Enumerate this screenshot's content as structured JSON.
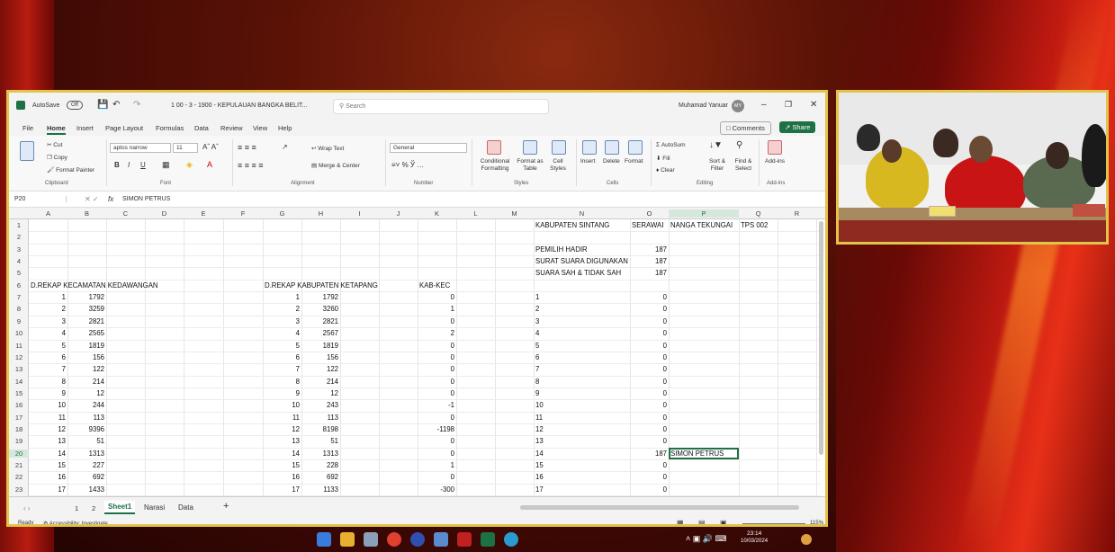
{
  "window": {
    "autosave": "AutoSave",
    "autosave_state": "Off",
    "filename": "1 00 - 3 - 1900 - KEPULAUAN BANGKA BELIT...",
    "search_placeholder": "Search",
    "user": "Muhamad Yanuar",
    "user_initials": "MY",
    "comments": "Comments",
    "share": "Share"
  },
  "menu": [
    "File",
    "Home",
    "Insert",
    "Page Layout",
    "Formulas",
    "Data",
    "Review",
    "View",
    "Help"
  ],
  "ribbon": {
    "cut": "Cut",
    "copy": "Copy",
    "format_painter": "Format Painter",
    "clipboard": "Clipboard",
    "font_name": "aptos narrow",
    "font_size": "11",
    "font_group": "Font",
    "alignment": "Alignment",
    "wrap_text": "Wrap Text",
    "merge_center": "Merge & Center",
    "number_format": "General",
    "number": "Number",
    "conditional": "Conditional Formatting",
    "format_table": "Format as Table",
    "cell_styles": "Cell Styles",
    "styles": "Styles",
    "insert": "Insert",
    "delete": "Delete",
    "format": "Format",
    "cells": "Cells",
    "autosum": "AutoSum",
    "fill": "Fill",
    "clear": "Clear",
    "sort_filter": "Sort & Filter",
    "find_select": "Find & Select",
    "editing": "Editing",
    "addins": "Add-ins",
    "addins_group": "Add-ins"
  },
  "formula": {
    "namebox": "P20",
    "fx": "fx",
    "content": "SIMON PETRUS"
  },
  "columns": [
    "A",
    "B",
    "C",
    "D",
    "E",
    "F",
    "G",
    "H",
    "I",
    "J",
    "K",
    "L",
    "M",
    "N",
    "O",
    "P",
    "Q",
    "R"
  ],
  "rows": [
    "1",
    "2",
    "3",
    "4",
    "5",
    "6",
    "7",
    "8",
    "9",
    "10",
    "11",
    "12",
    "13",
    "14",
    "15",
    "16",
    "17",
    "18",
    "19",
    "20",
    "21",
    "22",
    "23"
  ],
  "cells": {
    "n1": "KABUPATEN SINTANG",
    "o1": "SERAWAI",
    "p1": "NANGA TEKUNGAI",
    "q1": "TPS 002",
    "n3": "PEMILIH HADIR",
    "o3": "187",
    "n4": "SURAT SUARA DIGUNAKAN",
    "o4": "187",
    "n5": "SUARA SAH & TIDAK SAH",
    "o5": "187",
    "a6": "D.REKAP KECAMATAN KEDAWANGAN",
    "g6": "D.REKAP KABUPATEN KETAPANG",
    "k6": "KAB-KEC",
    "p20": "SIMON PETRUS"
  },
  "colA": [
    "1",
    "2",
    "3",
    "4",
    "5",
    "6",
    "7",
    "8",
    "9",
    "10",
    "11",
    "12",
    "13",
    "14",
    "15",
    "16",
    "17"
  ],
  "colB": [
    "1792",
    "3259",
    "2821",
    "2565",
    "1819",
    "156",
    "122",
    "214",
    "12",
    "244",
    "113",
    "9396",
    "51",
    "1313",
    "227",
    "692",
    "1433"
  ],
  "colG": [
    "1",
    "2",
    "3",
    "4",
    "5",
    "6",
    "7",
    "8",
    "9",
    "10",
    "11",
    "12",
    "13",
    "14",
    "15",
    "16",
    "17"
  ],
  "colH": [
    "1792",
    "3260",
    "2821",
    "2567",
    "1819",
    "156",
    "122",
    "214",
    "12",
    "243",
    "113",
    "8198",
    "51",
    "1313",
    "228",
    "692",
    "1133"
  ],
  "colK": [
    "0",
    "1",
    "0",
    "2",
    "0",
    "0",
    "0",
    "0",
    "0",
    "-1",
    "0",
    "-1198",
    "0",
    "0",
    "1",
    "0",
    "-300"
  ],
  "colN": [
    "1",
    "2",
    "3",
    "4",
    "5",
    "6",
    "7",
    "8",
    "9",
    "10",
    "11",
    "12",
    "13",
    "14",
    "15",
    "16",
    "17"
  ],
  "colO": [
    "0",
    "0",
    "0",
    "0",
    "0",
    "0",
    "0",
    "0",
    "0",
    "0",
    "0",
    "0",
    "0",
    "187",
    "0",
    "0",
    "0"
  ],
  "sheets": [
    "Sheet1",
    "Narasi",
    "Data"
  ],
  "pages": [
    "1",
    "2"
  ],
  "status": {
    "ready": "Ready",
    "accessibility": "Accessibility: Investigate",
    "zoom": "115%"
  },
  "clock": {
    "time": "23:14",
    "date": "10/03/2024"
  },
  "colors": {
    "excel_green": "#1e7145",
    "frame": "#e3c44a"
  }
}
